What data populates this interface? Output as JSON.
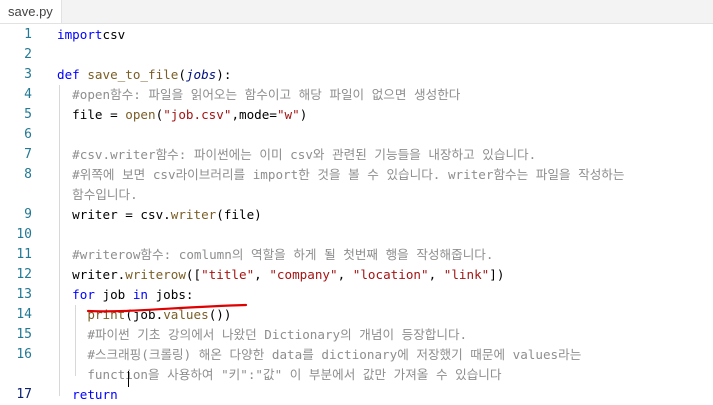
{
  "tab": {
    "filename": "save.py"
  },
  "lines": [
    {
      "n": "1",
      "tokens": [
        [
          "kw",
          "import"
        ],
        [
          "",
          "csv"
        ]
      ]
    },
    {
      "n": "2",
      "tokens": []
    },
    {
      "n": "3",
      "tokens": [
        [
          "kw",
          "def"
        ],
        [
          "",
          " "
        ],
        [
          "fn",
          "save_to_file"
        ],
        [
          "",
          "("
        ],
        [
          "it",
          "jobs"
        ],
        [
          "",
          "):"
        ]
      ]
    },
    {
      "n": "4",
      "tokens": [
        [
          "",
          "  "
        ],
        [
          "cm",
          "#open함수: 파일을 읽어오는 함수이고 해당 파일이 없으면 생성한다"
        ]
      ]
    },
    {
      "n": "5",
      "tokens": [
        [
          "",
          "  file = "
        ],
        [
          "fn",
          "open"
        ],
        [
          "",
          "("
        ],
        [
          "str",
          "\"job.csv\""
        ],
        [
          "",
          ",mode="
        ],
        [
          "str",
          "\"w\""
        ],
        [
          "",
          ")"
        ]
      ]
    },
    {
      "n": "6",
      "tokens": []
    },
    {
      "n": "7",
      "tokens": [
        [
          "",
          "  "
        ],
        [
          "cm",
          "#csv.writer함수: 파이썬에는 이미 csv와 관련된 기능들을 내장하고 있습니다."
        ]
      ]
    },
    {
      "n": "8",
      "tokens": [
        [
          "",
          "  "
        ],
        [
          "cm",
          "#위쪽에 보면 csv라이브러리를 import한 것을 볼 수 있습니다. writer함수는 파일을 작성하는"
        ]
      ]
    },
    {
      "n": "",
      "tokens": [
        [
          "",
          "  "
        ],
        [
          "cm",
          "함수입니다."
        ]
      ]
    },
    {
      "n": "9",
      "tokens": [
        [
          "",
          "  writer = csv."
        ],
        [
          "fn",
          "writer"
        ],
        [
          "",
          "(file)"
        ]
      ]
    },
    {
      "n": "10",
      "tokens": []
    },
    {
      "n": "11",
      "tokens": [
        [
          "",
          "  "
        ],
        [
          "cm",
          "#writerow함수: comlumn의 역할을 하게 될 첫번째 행을 작성해줍니다."
        ]
      ]
    },
    {
      "n": "12",
      "tokens": [
        [
          "",
          "  writer."
        ],
        [
          "fn",
          "writerow"
        ],
        [
          "",
          "(["
        ],
        [
          "str",
          "\"title\""
        ],
        [
          "",
          ", "
        ],
        [
          "str",
          "\"company\""
        ],
        [
          "",
          ", "
        ],
        [
          "str",
          "\"location\""
        ],
        [
          "",
          ", "
        ],
        [
          "str",
          "\"link\""
        ],
        [
          "",
          "])"
        ]
      ]
    },
    {
      "n": "13",
      "tokens": [
        [
          "",
          "  "
        ],
        [
          "kw",
          "for"
        ],
        [
          "",
          " job "
        ],
        [
          "kw",
          "in"
        ],
        [
          "",
          " jobs:"
        ]
      ]
    },
    {
      "n": "14",
      "tokens": [
        [
          "",
          "    "
        ],
        [
          "fn",
          "print"
        ],
        [
          "",
          "(job."
        ],
        [
          "fn",
          "values"
        ],
        [
          "",
          "())"
        ]
      ]
    },
    {
      "n": "15",
      "tokens": [
        [
          "",
          "    "
        ],
        [
          "cm",
          "#파이썬 기초 강의에서 나왔던 Dictionary의 개념이 등장합니다."
        ]
      ]
    },
    {
      "n": "16",
      "tokens": [
        [
          "",
          "    "
        ],
        [
          "cm",
          "#스크래핑(크롤링) 해온 다양한 data를 dictionary에 저장했기 때문에 values라는"
        ]
      ]
    },
    {
      "n": "",
      "tokens": [
        [
          "",
          "    "
        ],
        [
          "cm",
          "function을 사용하여 \"키\":\"값\" 이 부분에서 값만 가져올 수 있습니다"
        ]
      ]
    },
    {
      "n": "17",
      "tokens": [
        [
          "",
          "  "
        ],
        [
          "kw",
          "return"
        ],
        [
          "",
          " "
        ]
      ]
    }
  ],
  "colors": {
    "keyword": "#0000ff",
    "function": "#795e26",
    "string": "#a31515",
    "comment": "#8e8e8e",
    "line_number": "#237893",
    "annotation": "#e00000"
  }
}
